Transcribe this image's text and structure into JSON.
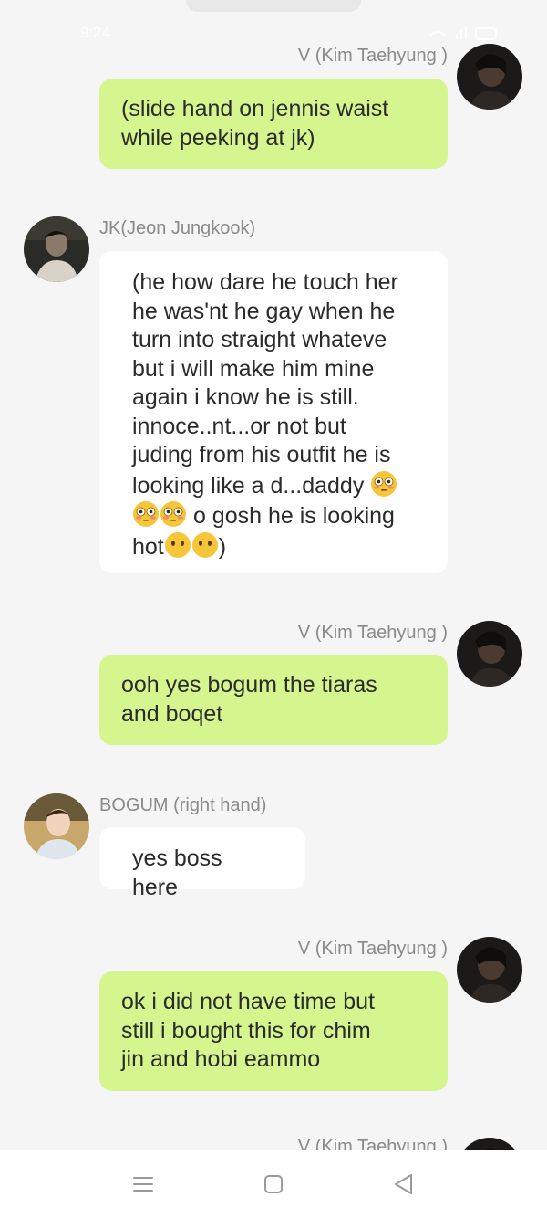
{
  "status_bar": {
    "time": "9:24",
    "icons": "wifi-icon signal-icon battery-icon"
  },
  "messages": [
    {
      "sender": "V (Kim Taehyung )",
      "side": "right",
      "color": "#d5f58e",
      "text": "(slide hand on jennis waist\nwhile peeking at jk)"
    },
    {
      "sender": "JK(Jeon Jungkook)",
      "side": "left",
      "color": "#ffffff",
      "text_a": "(he how dare he touch her\nhe was'nt he gay when he\nturn into straight whateve\nbut i will make him mine\nagain i know he is  still.\ninnoce..nt...or not but\njuding from his outfit he is\nlooking like a d...daddy ",
      "text_b": " o gosh he is looking\nhot",
      "text_c": ")"
    },
    {
      "sender": "V (Kim Taehyung )",
      "side": "right",
      "color": "#d5f58e",
      "text": "ooh yes bogum the tiaras\nand boqet"
    },
    {
      "sender": "BOGUM (right hand)",
      "side": "left",
      "color": "#ffffff",
      "text": "yes boss here"
    },
    {
      "sender": "V (Kim Taehyung )",
      "side": "right",
      "color": "#d5f58e",
      "text": "ok i did not have time but\nstill i bought this for chim\njin and hobi eammo"
    },
    {
      "sender": "V (Kim Taehyung )",
      "side": "right"
    }
  ],
  "nav": {
    "menu_icon": "menu-icon",
    "home_icon": "home-square-icon",
    "back_icon": "back-triangle-icon"
  }
}
